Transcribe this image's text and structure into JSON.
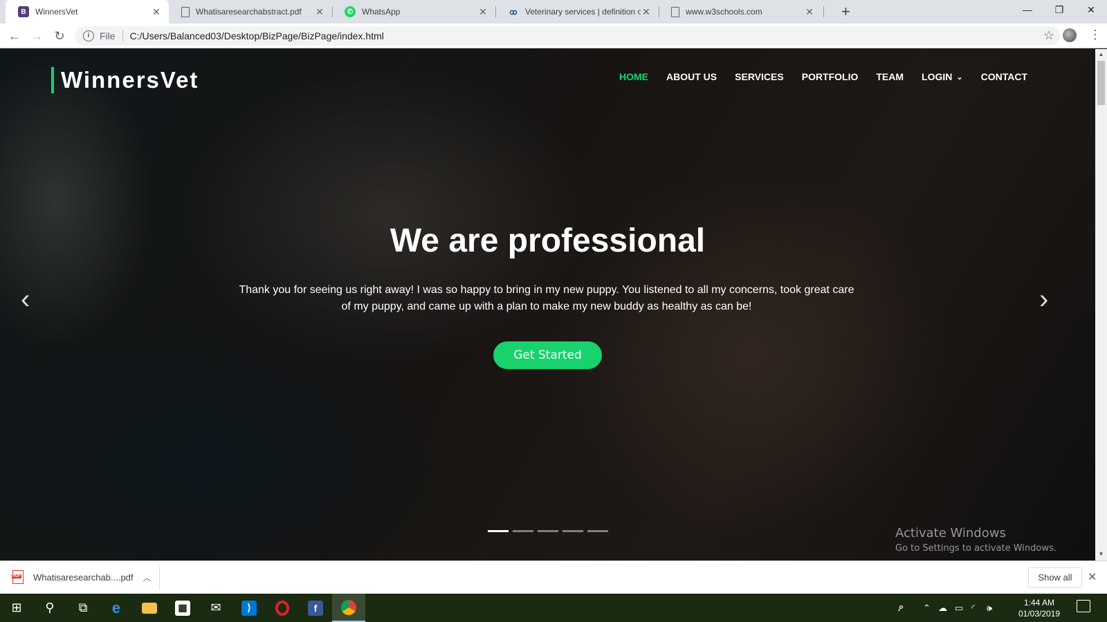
{
  "browser": {
    "tabs": [
      {
        "title": "WinnersVet",
        "favicon": "B",
        "favicon_color": "#563d7c",
        "active": true
      },
      {
        "title": "Whatisaresearchabstract.pdf",
        "favicon": "doc",
        "active": false
      },
      {
        "title": "WhatsApp",
        "favicon": "whatsapp",
        "favicon_color": "#25d366",
        "active": false
      },
      {
        "title": "Veterinary services | definition of",
        "favicon": "dictionary",
        "active": false
      },
      {
        "title": "www.w3schools.com",
        "favicon": "doc",
        "active": false
      }
    ],
    "new_tab_label": "+",
    "window_controls": {
      "minimize": "—",
      "restore": "❐",
      "close": "✕"
    },
    "address": {
      "scheme_label": "File",
      "url": "C:/Users/Balanced03/Desktop/BizPage/BizPage/index.html"
    }
  },
  "site": {
    "logo": "WinnersVet",
    "nav": [
      {
        "label": "HOME",
        "active": true
      },
      {
        "label": "ABOUT US",
        "active": false
      },
      {
        "label": "SERVICES",
        "active": false
      },
      {
        "label": "PORTFOLIO",
        "active": false
      },
      {
        "label": "TEAM",
        "active": false
      },
      {
        "label": "LOGIN",
        "active": false,
        "dropdown": true
      },
      {
        "label": "CONTACT",
        "active": false
      }
    ],
    "hero": {
      "title": "We are professional",
      "text": "Thank you for seeing us right away! I was so happy to bring in my new puppy. You listened to all my concerns, took great care of my puppy, and came up with a plan to make my new buddy as healthy as can be!",
      "cta": "Get Started",
      "slides": 5,
      "active_slide": 1
    },
    "accent_color": "#18d26e"
  },
  "watermark": {
    "title": "Activate Windows",
    "subtitle": "Go to Settings to activate Windows."
  },
  "downloads": {
    "file": "Whatisaresearchab....pdf",
    "show_all": "Show all"
  },
  "taskbar": {
    "apps": [
      "windows-start",
      "search",
      "task-view",
      "edge",
      "file-explorer",
      "store",
      "mail",
      "vscode",
      "opera",
      "facebook",
      "chrome"
    ],
    "active_app": "chrome",
    "clock": {
      "time": "1:44 AM",
      "date": "01/03/2019"
    }
  }
}
